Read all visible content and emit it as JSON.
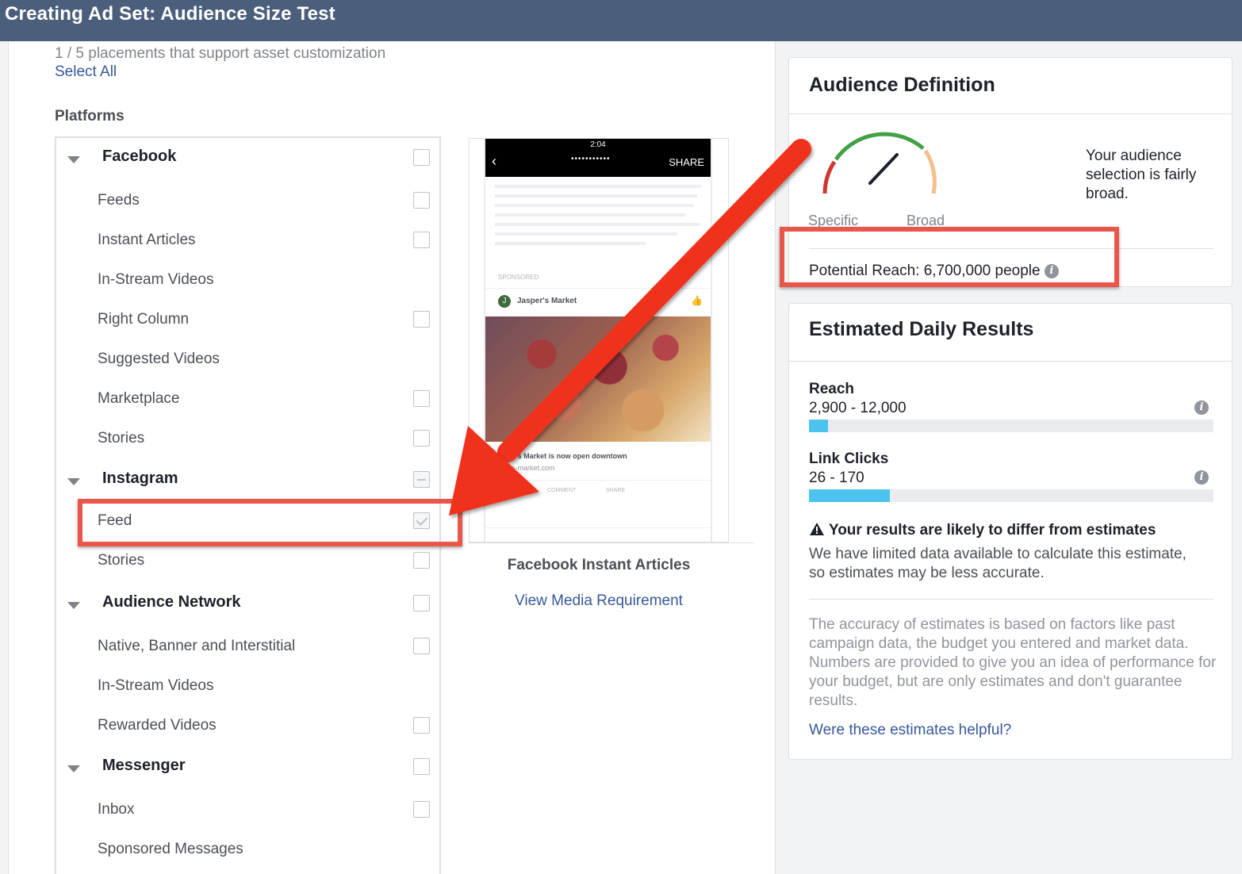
{
  "header": {
    "title": "Creating Ad Set: Audience Size Test"
  },
  "placements": {
    "count_text": "1 / 5 placements that support asset customization",
    "select_all": "Select All",
    "platforms_label": "Platforms",
    "groups": [
      {
        "name": "Facebook",
        "state": "unchecked",
        "items": [
          {
            "label": "Feeds",
            "state": "unchecked"
          },
          {
            "label": "Instant Articles",
            "state": "unchecked"
          },
          {
            "label": "In-Stream Videos",
            "state": "none"
          },
          {
            "label": "Right Column",
            "state": "unchecked"
          },
          {
            "label": "Suggested Videos",
            "state": "none"
          },
          {
            "label": "Marketplace",
            "state": "unchecked"
          },
          {
            "label": "Stories",
            "state": "unchecked"
          }
        ]
      },
      {
        "name": "Instagram",
        "state": "indeterminate",
        "items": [
          {
            "label": "Feed",
            "state": "checked"
          },
          {
            "label": "Stories",
            "state": "unchecked"
          }
        ]
      },
      {
        "name": "Audience Network",
        "state": "unchecked",
        "items": [
          {
            "label": "Native, Banner and Interstitial",
            "state": "unchecked"
          },
          {
            "label": "In-Stream Videos",
            "state": "none"
          },
          {
            "label": "Rewarded Videos",
            "state": "unchecked"
          }
        ]
      },
      {
        "name": "Messenger",
        "state": "unchecked",
        "items": [
          {
            "label": "Inbox",
            "state": "unchecked"
          },
          {
            "label": "Sponsored Messages",
            "state": "none"
          }
        ]
      }
    ]
  },
  "preview": {
    "phone_time": "2:04",
    "phone_share": "SHARE",
    "sponsored": "SPONSORED",
    "brand": "Jasper's Market",
    "caption": "er's Market is now open downtown",
    "url": "rs-market.com",
    "actions": [
      "LIKE",
      "COMMENT",
      "SHARE"
    ],
    "title": "Facebook Instant Articles",
    "link": "View Media Requirement"
  },
  "audience": {
    "heading": "Audience Definition",
    "gauge_specific": "Specific",
    "gauge_broad": "Broad",
    "description": "Your audience selection is fairly broad.",
    "potential_reach": "Potential Reach: 6,700,000 people",
    "gauge_colors": {
      "left": "#d0382f",
      "middle": "#42a047",
      "right": "#f3c08c"
    }
  },
  "estimates": {
    "heading": "Estimated Daily Results",
    "metrics": [
      {
        "name": "Reach",
        "value": "2,900 - 12,000",
        "fill": 0.047
      },
      {
        "name": "Link Clicks",
        "value": "26 - 170",
        "fill": 0.2
      }
    ],
    "warning_title": "Your results are likely to differ from estimates",
    "warning_body": "We have limited data available to calculate this estimate, so estimates may be less accurate.",
    "accuracy_body": "The accuracy of estimates is based on factors like past campaign data, the budget you entered and market data. Numbers are provided to give you an idea of performance for your budget, but are only estimates and don't guarantee results.",
    "helpful_link": "Were these estimates helpful?"
  },
  "annotations": {
    "highlight_color": "#e9574a",
    "arrow_color": "#f0321e"
  }
}
